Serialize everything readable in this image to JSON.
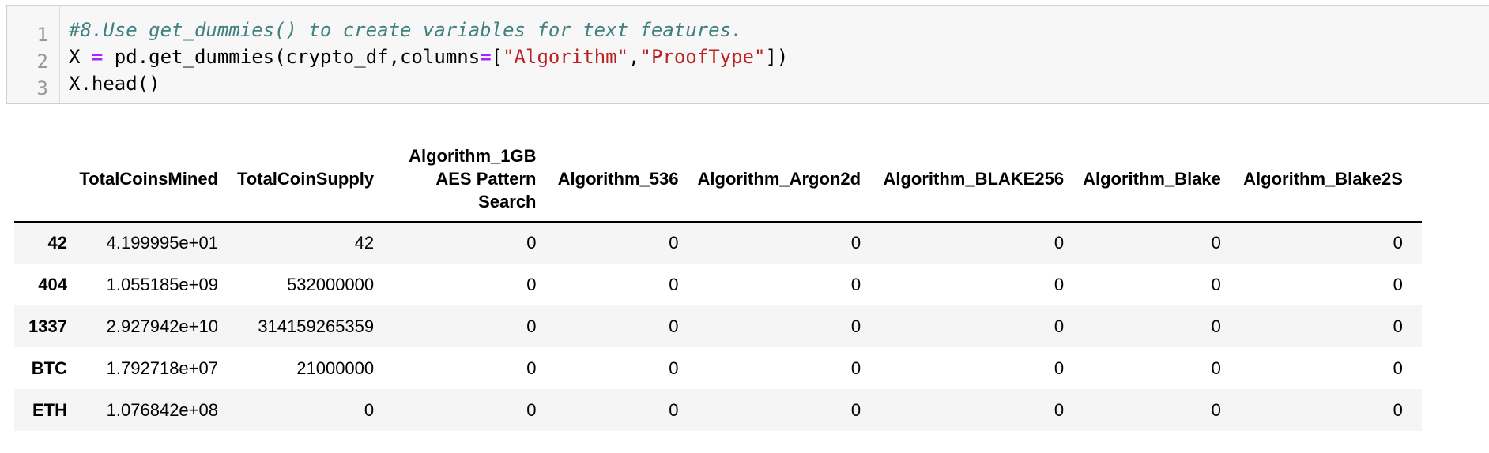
{
  "code_cell": {
    "line_numbers": [
      "1",
      "2",
      "3"
    ],
    "line1": {
      "comment": "#8.Use get_dummies() to create variables for text features."
    },
    "line2": {
      "var": "X ",
      "op": "=",
      "call": " pd.get_dummies(crypto_df,columns",
      "op2": "=",
      "open": "[",
      "str1": "\"Algorithm\"",
      "comma": ",",
      "str2": "\"ProofType\"",
      "close": "])"
    },
    "line3": {
      "text": "X.head()"
    }
  },
  "dataframe": {
    "columns": [
      "TotalCoinsMined",
      "TotalCoinSupply",
      "Algorithm_1GB AES Pattern Search",
      "Algorithm_536",
      "Algorithm_Argon2d",
      "Algorithm_BLAKE256",
      "Algorithm_Blake",
      "Algorithm_Blake2S"
    ],
    "rows": [
      {
        "index": "42",
        "values": [
          "4.199995e+01",
          "42",
          "0",
          "0",
          "0",
          "0",
          "0",
          "0"
        ]
      },
      {
        "index": "404",
        "values": [
          "1.055185e+09",
          "532000000",
          "0",
          "0",
          "0",
          "0",
          "0",
          "0"
        ]
      },
      {
        "index": "1337",
        "values": [
          "2.927942e+10",
          "314159265359",
          "0",
          "0",
          "0",
          "0",
          "0",
          "0"
        ]
      },
      {
        "index": "BTC",
        "values": [
          "1.792718e+07",
          "21000000",
          "0",
          "0",
          "0",
          "0",
          "0",
          "0"
        ]
      },
      {
        "index": "ETH",
        "values": [
          "1.076842e+08",
          "0",
          "0",
          "0",
          "0",
          "0",
          "0",
          "0"
        ]
      }
    ]
  }
}
